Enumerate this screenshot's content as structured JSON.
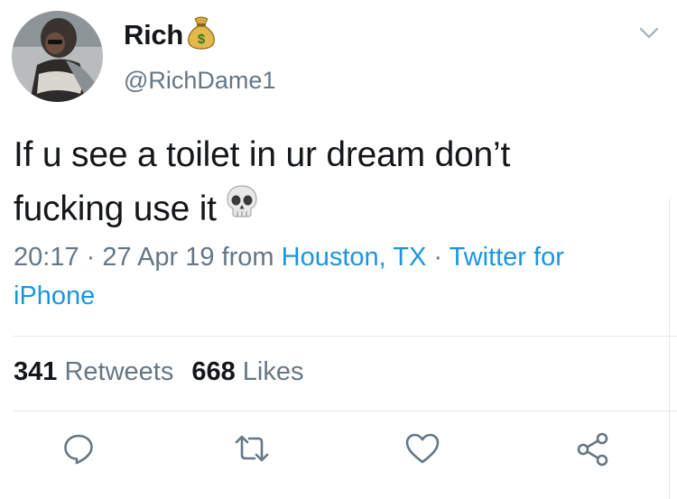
{
  "tweet": {
    "display_name": "Rich",
    "name_emoji": "money-bag-icon",
    "handle": "@RichDame1",
    "text_line1": "If u see a toilet in ur dream don’t",
    "text_line2": "fucking use it",
    "text_emoji": "skull-icon",
    "time": "20:17",
    "sep1": " · ",
    "date": "27 Apr 19",
    "from_word": " from ",
    "location": "Houston, TX",
    "sep2": " · ",
    "client": "Twitter for iPhone"
  },
  "stats": {
    "retweets_count": "341",
    "retweets_label": " Retweets",
    "likes_count": "668",
    "likes_label": " Likes"
  },
  "actions": [
    "reply-icon",
    "retweet-icon",
    "like-icon",
    "share-icon"
  ],
  "colors": {
    "text": "#14171a",
    "secondary": "#657786",
    "link": "#1b95e0",
    "divider": "#e1e8ed"
  }
}
